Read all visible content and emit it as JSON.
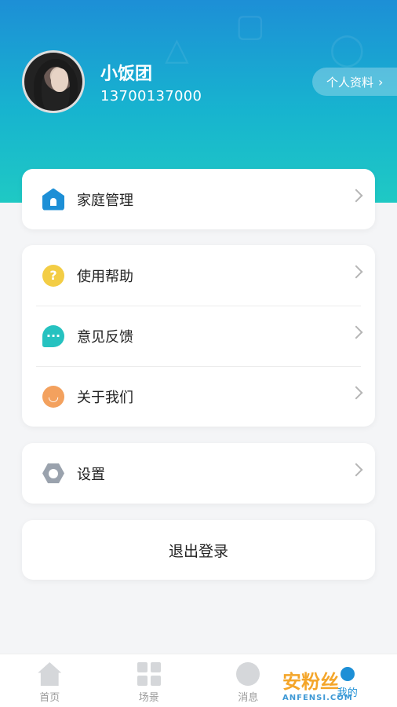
{
  "header": {
    "username": "小饭团",
    "phone": "13700137000",
    "profile_button": "个人资料"
  },
  "menu_groups": [
    [
      {
        "label": "家庭管理",
        "icon": "home-icon"
      }
    ],
    [
      {
        "label": "使用帮助",
        "icon": "help-icon"
      },
      {
        "label": "意见反馈",
        "icon": "feedback-icon"
      },
      {
        "label": "关于我们",
        "icon": "smile-icon"
      }
    ],
    [
      {
        "label": "设置",
        "icon": "settings-icon"
      }
    ]
  ],
  "logout_label": "退出登录",
  "tabbar": [
    {
      "label": "首页",
      "icon": "home-tab-icon"
    },
    {
      "label": "场景",
      "icon": "grid-icon"
    },
    {
      "label": "消息",
      "icon": "message-icon"
    },
    {
      "label": "我的",
      "icon": "user-icon",
      "active": true
    }
  ],
  "watermark": {
    "text": "安粉丝",
    "sub": "ANFENSI.COM"
  },
  "colors": {
    "accent": "#1d8fd6",
    "gradient_end": "#1fc9c4",
    "help": "#f3cd45",
    "feedback": "#26c2c0",
    "about": "#f3a15e",
    "settings": "#9aa2ad"
  }
}
